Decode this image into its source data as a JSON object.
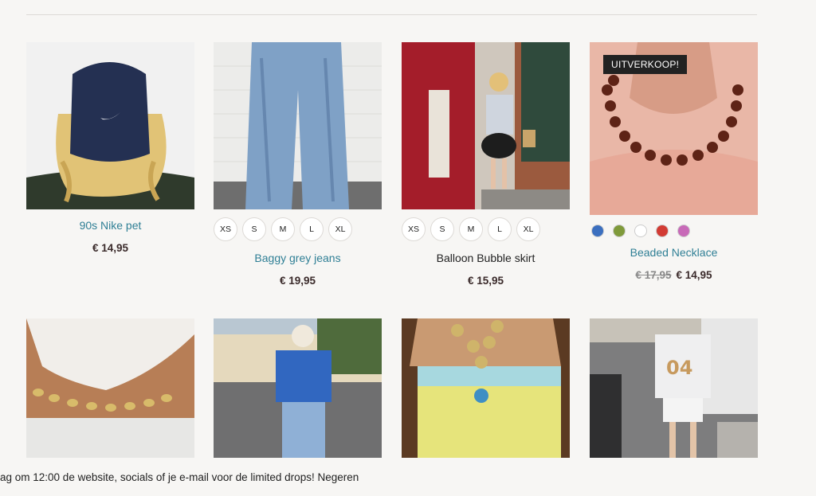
{
  "products_row1": [
    {
      "title": "90s Nike pet",
      "price": "€ 14,95",
      "image_desc": "nike-cap-image"
    },
    {
      "title": "Baggy grey jeans",
      "price": "€ 19,95",
      "sizes": [
        "XS",
        "S",
        "M",
        "L",
        "XL"
      ],
      "image_desc": "jeans-image"
    },
    {
      "title": "Balloon Bubble skirt",
      "price": "€ 15,95",
      "sizes": [
        "XS",
        "S",
        "M",
        "L",
        "XL"
      ],
      "image_desc": "skirt-image"
    },
    {
      "title": "Beaded Necklace",
      "old_price": "€ 17,95",
      "price": "€ 14,95",
      "badge": "UITVERKOOP!",
      "swatches": [
        "#3b6fbf",
        "#7f9a3a",
        "#ffffff",
        "#d23b33",
        "#c86ab8"
      ],
      "image_desc": "necklace-image"
    }
  ],
  "footer": {
    "text": "ag om 12:00 de website, socials of je e-mail voor de limited drops! Negeren"
  },
  "colors": {
    "link": "#2f7f95",
    "background": "#f7f6f4",
    "badge": "#222222"
  }
}
